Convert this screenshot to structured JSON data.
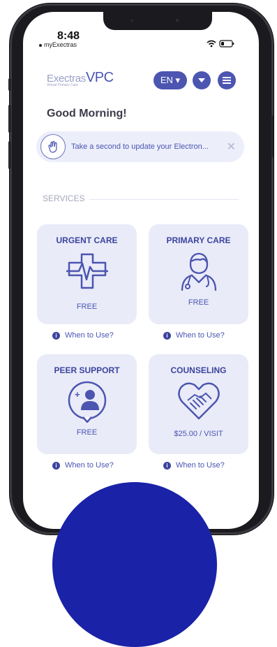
{
  "status_bar": {
    "time": "8:48",
    "carrier": "myExectras"
  },
  "header": {
    "logo_exectras": "Exectras",
    "logo_vpc": "VPC",
    "logo_subtitle": "Virtual Primary Care",
    "language_label": "EN ▾",
    "dropdown_icon": "chevron-down-icon",
    "menu_icon": "hamburger-menu-icon"
  },
  "greeting": "Good Morning!",
  "banner": {
    "text": "Take a second to update your Electron...",
    "close": "✕"
  },
  "services": {
    "title": "SERVICES",
    "cards": [
      {
        "title": "URGENT CARE",
        "price": "FREE",
        "icon": "medical-cross-heartbeat-icon",
        "help": "When to Use?"
      },
      {
        "title": "PRIMARY CARE",
        "price": "FREE",
        "icon": "doctor-stethoscope-icon",
        "help": "When to Use?"
      },
      {
        "title": "PEER SUPPORT",
        "price": "FREE",
        "icon": "add-person-chat-icon",
        "help": "When to Use?"
      },
      {
        "title": "COUNSELING",
        "price": "$25.00 / VISIT",
        "icon": "heart-handshake-icon",
        "help": "When to Use?"
      }
    ]
  },
  "colors": {
    "accent": "#4c55b0",
    "card_bg": "#e9ebf8",
    "brand_dark": "#3c449e",
    "cta_circle": "#1a22a8"
  }
}
